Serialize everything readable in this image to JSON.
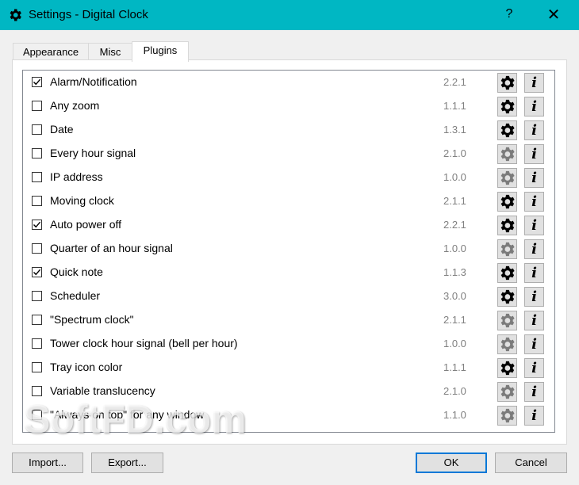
{
  "window": {
    "title": "Settings - Digital Clock",
    "help_label": "?",
    "close_label": "✕",
    "icon": "gear-icon"
  },
  "tabs": [
    {
      "label": "Appearance",
      "active": false
    },
    {
      "label": "Misc",
      "active": false
    },
    {
      "label": "Plugins",
      "active": true
    }
  ],
  "plugins": [
    {
      "name": "Alarm/Notification",
      "version": "2.2.1",
      "checked": true,
      "configurable": true
    },
    {
      "name": "Any zoom",
      "version": "1.1.1",
      "checked": false,
      "configurable": true
    },
    {
      "name": "Date",
      "version": "1.3.1",
      "checked": false,
      "configurable": true
    },
    {
      "name": "Every hour signal",
      "version": "2.1.0",
      "checked": false,
      "configurable": false
    },
    {
      "name": "IP address",
      "version": "1.0.0",
      "checked": false,
      "configurable": false
    },
    {
      "name": "Moving clock",
      "version": "2.1.1",
      "checked": false,
      "configurable": true
    },
    {
      "name": "Auto power off",
      "version": "2.2.1",
      "checked": true,
      "configurable": true
    },
    {
      "name": "Quarter of an hour signal",
      "version": "1.0.0",
      "checked": false,
      "configurable": false
    },
    {
      "name": "Quick note",
      "version": "1.1.3",
      "checked": true,
      "configurable": true
    },
    {
      "name": "Scheduler",
      "version": "3.0.0",
      "checked": false,
      "configurable": true
    },
    {
      "name": "\"Spectrum clock\"",
      "version": "2.1.1",
      "checked": false,
      "configurable": false
    },
    {
      "name": "Tower clock hour signal (bell per hour)",
      "version": "1.0.0",
      "checked": false,
      "configurable": false
    },
    {
      "name": "Tray icon color",
      "version": "1.1.1",
      "checked": false,
      "configurable": true
    },
    {
      "name": "Variable translucency",
      "version": "2.1.0",
      "checked": false,
      "configurable": false
    },
    {
      "name": "\"Always on top\" for any window",
      "version": "1.1.0",
      "checked": false,
      "configurable": false
    }
  ],
  "info_label": "i",
  "buttons": {
    "import": "Import...",
    "export": "Export...",
    "ok": "OK",
    "cancel": "Cancel"
  },
  "watermark": "SoftFD.com",
  "colors": {
    "titlebar": "#00b7c3",
    "version_text": "#808080",
    "default_button_border": "#0078d7"
  }
}
